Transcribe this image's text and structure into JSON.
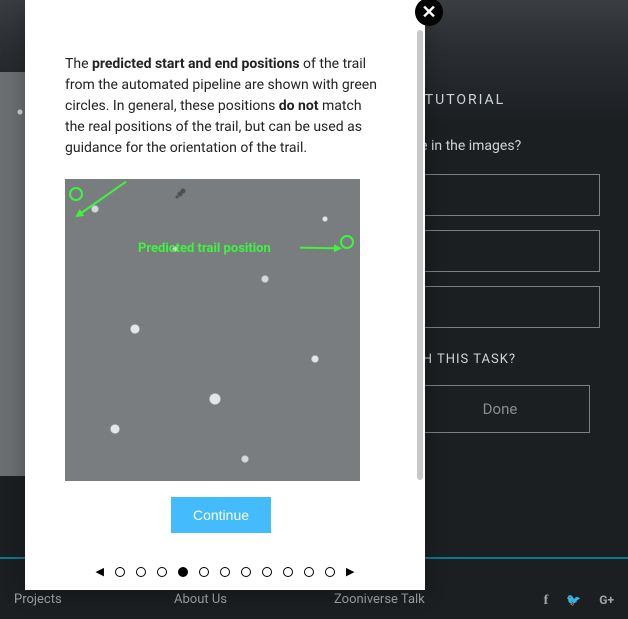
{
  "sidebar": {
    "tutorial_heading": "TUTORIAL",
    "question": "ble in the images?",
    "need_help": "TH THIS TASK?",
    "done_label": "Done"
  },
  "footer": {
    "col1": {
      "item1": "Projects",
      "item2": ""
    },
    "col2": {
      "item1": "About Us",
      "item2": ""
    },
    "col3": {
      "item1": "Zooniverse Talk",
      "item2": ""
    }
  },
  "modal": {
    "text_p1_a": "The ",
    "text_p1_strong1": "predicted start and end positions",
    "text_p1_b": " of the trail from the automated pipeline are shown with green circles. In general, these positions ",
    "text_p1_strong2": "do not",
    "text_p1_c": " match the real positions of the trail, but can be used as guidance for the orientation of the trail.",
    "image_label": "Predicted trail position",
    "continue_label": "Continue",
    "pagination": {
      "total": 11,
      "active_index": 3
    }
  }
}
